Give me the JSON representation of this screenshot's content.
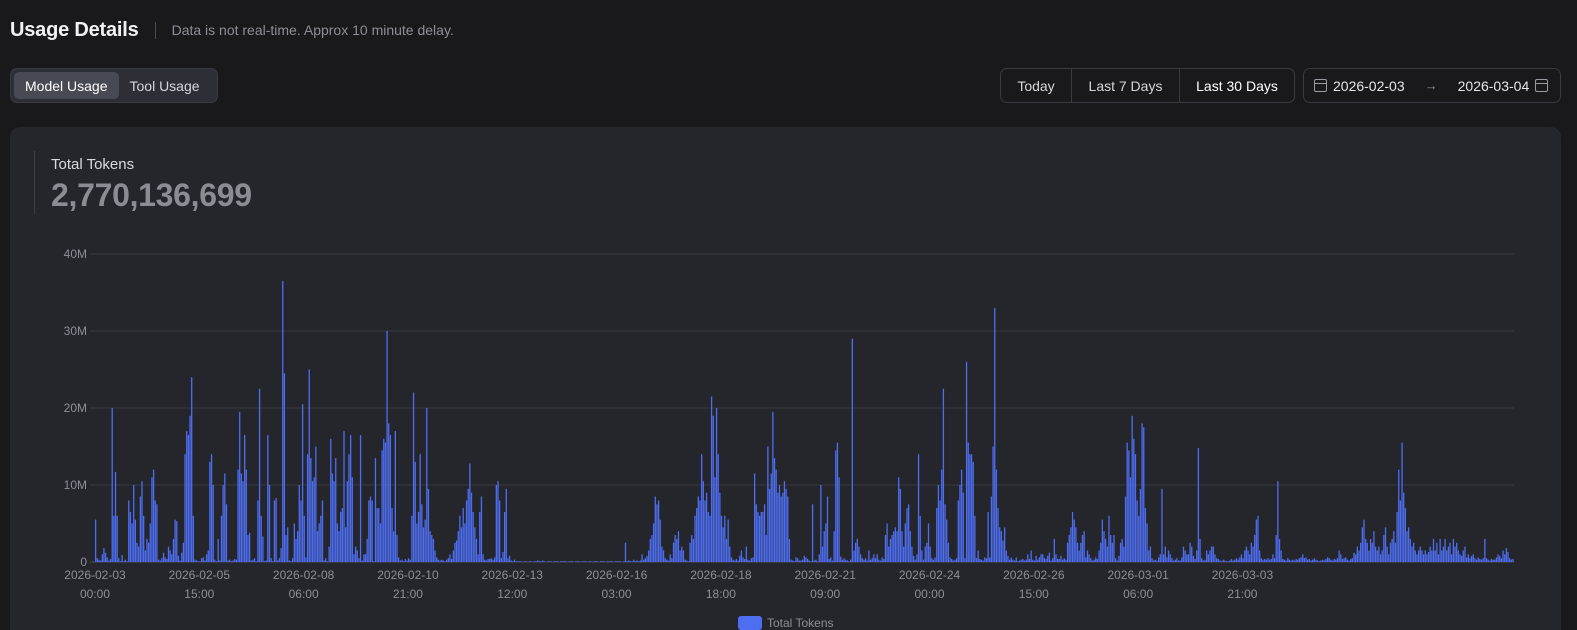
{
  "header": {
    "title": "Usage Details",
    "subtitle": "Data is not real-time. Approx 10 minute delay."
  },
  "tabs": [
    {
      "label": "Model Usage",
      "active": true
    },
    {
      "label": "Tool Usage",
      "active": false
    }
  ],
  "range_buttons": [
    {
      "label": "Today"
    },
    {
      "label": "Last 7 Days"
    },
    {
      "label": "Last 30 Days",
      "active": true
    }
  ],
  "date_range": {
    "start": "2026-02-03",
    "separator": "→",
    "end": "2026-03-04",
    "icon": "calendar-icon"
  },
  "stat": {
    "label": "Total Tokens",
    "value": "2,770,136,699"
  },
  "chart_data": {
    "type": "bar",
    "series_name": "Total Tokens",
    "color": "#4e6ef2",
    "ylim": [
      0,
      40000000
    ],
    "y_ticks": [
      {
        "value": 0,
        "label": "0"
      },
      {
        "value": 10000000,
        "label": "10M"
      },
      {
        "value": 20000000,
        "label": "20M"
      },
      {
        "value": 30000000,
        "label": "30M"
      },
      {
        "value": 40000000,
        "label": "40M"
      }
    ],
    "x_ticks": [
      {
        "date": "2026-02-03",
        "time": "00:00"
      },
      {
        "date": "2026-02-05",
        "time": "15:00"
      },
      {
        "date": "2026-02-08",
        "time": "06:00"
      },
      {
        "date": "2026-02-10",
        "time": "21:00"
      },
      {
        "date": "2026-02-13",
        "time": "12:00"
      },
      {
        "date": "2026-02-16",
        "time": "03:00"
      },
      {
        "date": "2026-02-18",
        "time": "18:00"
      },
      {
        "date": "2026-02-21",
        "time": "09:00"
      },
      {
        "date": "2026-02-24",
        "time": "00:00"
      },
      {
        "date": "2026-02-26",
        "time": "15:00"
      },
      {
        "date": "2026-03-01",
        "time": "06:00"
      },
      {
        "date": "2026-03-03",
        "time": "21:00"
      }
    ],
    "hours_per_bar": 1,
    "start": "2026-02-03 00:00",
    "unit": "millions of tokens",
    "values": [
      5.5,
      0.5,
      0.3,
      0.2,
      1.0,
      1.8,
      1.2,
      0.6,
      0.2,
      0.4,
      20.0,
      6.0,
      11.7,
      6.0,
      0.5,
      0.1,
      0.9,
      0.1,
      0.3,
      0.1,
      8.0,
      6.5,
      5.0,
      10.0,
      5.5,
      2.5,
      2.0,
      8.5,
      10.5,
      6.0,
      1.5,
      3.0,
      2.5,
      5.0,
      11.0,
      12.0,
      8.0,
      7.5,
      0.3,
      0.2,
      0.5,
      1.2,
      0.6,
      0.4,
      2.0,
      1.5,
      1.0,
      3.0,
      5.5,
      5.3,
      0.8,
      0.2,
      1.2,
      2.5,
      14.0,
      17.0,
      16.5,
      19.0,
      24.0,
      6.0,
      0.3,
      0.2,
      0.1,
      0.1,
      0.5,
      0.6,
      0.2,
      1.0,
      1.5,
      13.0,
      14.0,
      10.0,
      0.3,
      0.1,
      3.0,
      0.2,
      6.0,
      10.0,
      11.5,
      7.5,
      0.2,
      0.3,
      0.1,
      0.2,
      0.4,
      0.3,
      12.0,
      19.5,
      11.5,
      10.5,
      16.5,
      12.0,
      3.5,
      3.8,
      0.2,
      0.3,
      0.5,
      0.1,
      8.0,
      22.5,
      6.0,
      3.3,
      0.1,
      0.2,
      16.5,
      10.0,
      0.5,
      0.1,
      8.0,
      8.3,
      0.2,
      0.5,
      1.8,
      36.5,
      24.5,
      3.5,
      4.5,
      0.2,
      0.1,
      0.5,
      5.0,
      3.0,
      4.0,
      10.0,
      8.0,
      20.5,
      6.0,
      0.6,
      14.0,
      25.0,
      13.5,
      10.5,
      11.0,
      15.0,
      4.0,
      5.0,
      6.0,
      8.0,
      0.2,
      0.5,
      0.1,
      2.0,
      16.0,
      11.5,
      10.5,
      13.5,
      5.0,
      4.0,
      6.5,
      7.0,
      17.0,
      4.5,
      10.5,
      14.0,
      16.5,
      11.0,
      1.0,
      2.0,
      1.5,
      0.5,
      16.5,
      0.2,
      1.0,
      1.0,
      3.0,
      8.0,
      8.5,
      8.0,
      0.1,
      13.5,
      7.0,
      7.0,
      5.0,
      14.5,
      16.0,
      15.5,
      30.0,
      18.0,
      16.5,
      7.0,
      4.0,
      17.0,
      3.5,
      0.6,
      0.2,
      0.3,
      0.1,
      0.4,
      0.2,
      0.5,
      0.3,
      6.0,
      22.0,
      13.0,
      5.0,
      6.5,
      14.0,
      7.5,
      4.5,
      5.5,
      20.0,
      9.5,
      4.0,
      3.5,
      3.0,
      1.5,
      0.6,
      0.3,
      0.2,
      0.3,
      0.2,
      0.1,
      0.3,
      0.5,
      1.0,
      0.4,
      1.5,
      2.5,
      2.8,
      4.0,
      6.0,
      4.5,
      7.0,
      5.0,
      8.0,
      9.5,
      12.8,
      9.0,
      6.5,
      4.5,
      3.0,
      1.0,
      6.5,
      8.5,
      1.0,
      0.3,
      0.2,
      0.4,
      0.4,
      0.5,
      0.3,
      0.6,
      10.0,
      10.5,
      8.0,
      0.5,
      1.3,
      6.5,
      9.5,
      0.5,
      0.8,
      0.2,
      0.1,
      0.3,
      0.1,
      0.1,
      0.1,
      0.1,
      0.0,
      0.1,
      0.1,
      0.0,
      0.1,
      0.1,
      0.0,
      0.1,
      0.1,
      0.2,
      0.1,
      0.1,
      0.2,
      0.1,
      0.0,
      0.1,
      0.1,
      0.1,
      0.0,
      0.1,
      0.1,
      0.1,
      0.0,
      0.1,
      0.1,
      0.1,
      0.1,
      0.0,
      0.1,
      0.1,
      0.1,
      0.0,
      0.1,
      0.1,
      0.1,
      0.0,
      0.1,
      0.1,
      0.1,
      0.0,
      0.1,
      0.1,
      0.0,
      0.1,
      0.1,
      0.1,
      0.0,
      0.1,
      0.1,
      0.1,
      0.0,
      0.1,
      0.1,
      0.1,
      0.1,
      0.0,
      0.1,
      0.1,
      0.1,
      0.1,
      0.0,
      0.1,
      2.5,
      0.1,
      0.2,
      0.1,
      0.1,
      0.3,
      0.1,
      0.2,
      0.1,
      0.2,
      1.0,
      0.3,
      0.5,
      0.8,
      1.5,
      3.0,
      3.5,
      5.0,
      8.5,
      7.5,
      8.0,
      5.5,
      2.0,
      1.5,
      0.5,
      0.3,
      0.2,
      1.0,
      0.5,
      2.5,
      3.5,
      3.0,
      4.0,
      1.5,
      2.0,
      1.5,
      0.3,
      0.2,
      0.1,
      2.5,
      3.5,
      3.0,
      6.0,
      7.0,
      8.5,
      8.0,
      14.0,
      10.5,
      8.0,
      9.0,
      6.5,
      6.0,
      21.5,
      19.0,
      11.0,
      20.0,
      14.0,
      9.0,
      6.0,
      4.5,
      6.0,
      3.0,
      5.5,
      2.0,
      0.6,
      0.3,
      0.2,
      0.4,
      0.2,
      0.8,
      1.5,
      0.6,
      0.4,
      2.0,
      0.3,
      0.2,
      0.5,
      0.6,
      11.5,
      7.5,
      6.5,
      6.0,
      6.5,
      6.5,
      7.5,
      3.5,
      15.0,
      9.5,
      11.5,
      19.5,
      13.5,
      12.0,
      9.0,
      10.0,
      8.5,
      9.0,
      10.5,
      9.5,
      8.5,
      3.0,
      0.3,
      0.2,
      0.1,
      0.6,
      0.5,
      0.2,
      0.2,
      0.3,
      0.8,
      0.6,
      0.4,
      0.2,
      0.1,
      7.5,
      0.2,
      0.3,
      0.1,
      1.0,
      10.0,
      2.0,
      4.0,
      5.0,
      8.5,
      0.4,
      0.6,
      0.2,
      4.0,
      14.5,
      15.5,
      11.0,
      0.7,
      0.3,
      0.5,
      0.3,
      0.2,
      0.1,
      0.3,
      29.0,
      1.5,
      2.5,
      3.0,
      2.0,
      1.0,
      0.5,
      0.3,
      0.5,
      0.2,
      1.5,
      0.3,
      0.5,
      1.0,
      0.5,
      1.0,
      0.3,
      0.2,
      0.6,
      0.4,
      3.5,
      5.0,
      2.0,
      3.0,
      3.5,
      4.0,
      4.5,
      4.0,
      11.0,
      9.5,
      4.0,
      2.0,
      5.0,
      7.0,
      7.5,
      4.0,
      2.0,
      0.8,
      0.3,
      1.0,
      14.0,
      6.0,
      1.5,
      0.3,
      2.0,
      2.5,
      5.0,
      2.0,
      0.5,
      0.3,
      0.6,
      7.0,
      10.0,
      8.0,
      12.0,
      22.5,
      7.5,
      5.5,
      2.5,
      0.6,
      0.4,
      0.2,
      0.3,
      0.5,
      8.0,
      10.0,
      12.0,
      9.0,
      0.5,
      26.0,
      15.5,
      14.0,
      14.0,
      13.0,
      6.0,
      0.5,
      1.5,
      0.4,
      0.3,
      0.2,
      0.6,
      0.5,
      6.5,
      0.6,
      8.5,
      15.0,
      33.0,
      12.0,
      7.0,
      4.5,
      4.0,
      2.8,
      4.5,
      1.5,
      0.8,
      0.3,
      0.6,
      0.3,
      0.2,
      0.6,
      0.1,
      0.2,
      0.3,
      0.4,
      0.2,
      0.3,
      1.0,
      0.4,
      1.5,
      0.3,
      0.2,
      0.8,
      0.3,
      0.6,
      1.0,
      1.0,
      0.5,
      0.4,
      0.8,
      1.2,
      0.2,
      0.5,
      3.0,
      1.0,
      0.4,
      0.4,
      0.8,
      0.3,
      0.5,
      0.3,
      2.5,
      3.5,
      4.5,
      6.5,
      5.5,
      4.5,
      2.5,
      1.5,
      2.5,
      3.5,
      4.0,
      0.6,
      1.5,
      1.0,
      0.5,
      0.2,
      0.3,
      0.6,
      0.4,
      1.5,
      2.5,
      5.5,
      4.0,
      3.0,
      2.0,
      6.0,
      3.5,
      2.5,
      3.5,
      0.5,
      0.2,
      0.8,
      2.5,
      3.0,
      2.0,
      8.5,
      15.5,
      14.5,
      11.0,
      19.0,
      16.0,
      14.0,
      8.0,
      6.0,
      9.5,
      18.0,
      17.5,
      7.0,
      5.0,
      1.5,
      2.0,
      0.5,
      0.2,
      0.3,
      0.2,
      0.6,
      1.0,
      9.5,
      1.0,
      2.0,
      0.6,
      1.5,
      1.0,
      0.5,
      0.2,
      0.3,
      0.5,
      0.2,
      0.2,
      0.6,
      2.0,
      1.5,
      1.0,
      1.0,
      2.5,
      2.0,
      0.8,
      0.4,
      1.5,
      14.8,
      3.0,
      0.5,
      0.2,
      0.3,
      1.5,
      1.0,
      1.5,
      2.0,
      2.0,
      1.0,
      0.5,
      0.4,
      0.2,
      0.1,
      0.3,
      0.2,
      0.1,
      0.1,
      0.2,
      0.4,
      0.2,
      0.3,
      0.5,
      0.3,
      0.6,
      1.0,
      0.5,
      1.5,
      2.0,
      1.5,
      1.0,
      2.5,
      2.0,
      3.5,
      5.5,
      6.0,
      1.5,
      0.5,
      0.3,
      0.4,
      0.3,
      0.5,
      0.3,
      0.4,
      1.0,
      0.5,
      3.5,
      10.5,
      3.0,
      1.5,
      0.4,
      0.3,
      0.2,
      0.5,
      0.3,
      0.2,
      0.3,
      0.2,
      0.4,
      0.3,
      0.5,
      0.6,
      1.0,
      0.5,
      0.6,
      0.3,
      0.4,
      0.2,
      0.3,
      0.5,
      0.3,
      0.2,
      0.1,
      0.2,
      0.3,
      0.2,
      0.4,
      0.6,
      0.5,
      0.3,
      0.2,
      0.4,
      0.3,
      0.5,
      1.5,
      1.0,
      0.4,
      0.5,
      0.6,
      0.3,
      0.2,
      0.4,
      0.5,
      1.2,
      1.0,
      2.0,
      1.5,
      2.5,
      4.5,
      5.5,
      3.0,
      2.5,
      1.5,
      3.0,
      2.5,
      4.0,
      2.0,
      1.5,
      2.0,
      1.0,
      1.5,
      3.5,
      4.5,
      2.0,
      1.0,
      2.5,
      3.0,
      4.0,
      2.5,
      6.5,
      12.0,
      8.0,
      15.5,
      9.0,
      7.0,
      4.0,
      4.5,
      3.0,
      2.0,
      2.5,
      1.5,
      1.0,
      1.5,
      2.0,
      1.5,
      1.0,
      1.5,
      1.0,
      1.3,
      2.0,
      1.5,
      3.0,
      1.5,
      2.5,
      1.0,
      3.0,
      1.5,
      2.0,
      3.0,
      1.5,
      2.0,
      2.5,
      1.0,
      3.0,
      2.0,
      2.5,
      1.5,
      1.0,
      0.8,
      1.5,
      2.0,
      0.6,
      1.0,
      0.5,
      0.8,
      1.0,
      0.5,
      0.3,
      0.6,
      0.4,
      0.3,
      0.5,
      3.0,
      0.5,
      0.3,
      0.2,
      0.4,
      0.3,
      0.3,
      0.6,
      1.0,
      0.8,
      0.5,
      1.5,
      1.0,
      1.8,
      1.3,
      0.5,
      0.3,
      0.4
    ]
  }
}
